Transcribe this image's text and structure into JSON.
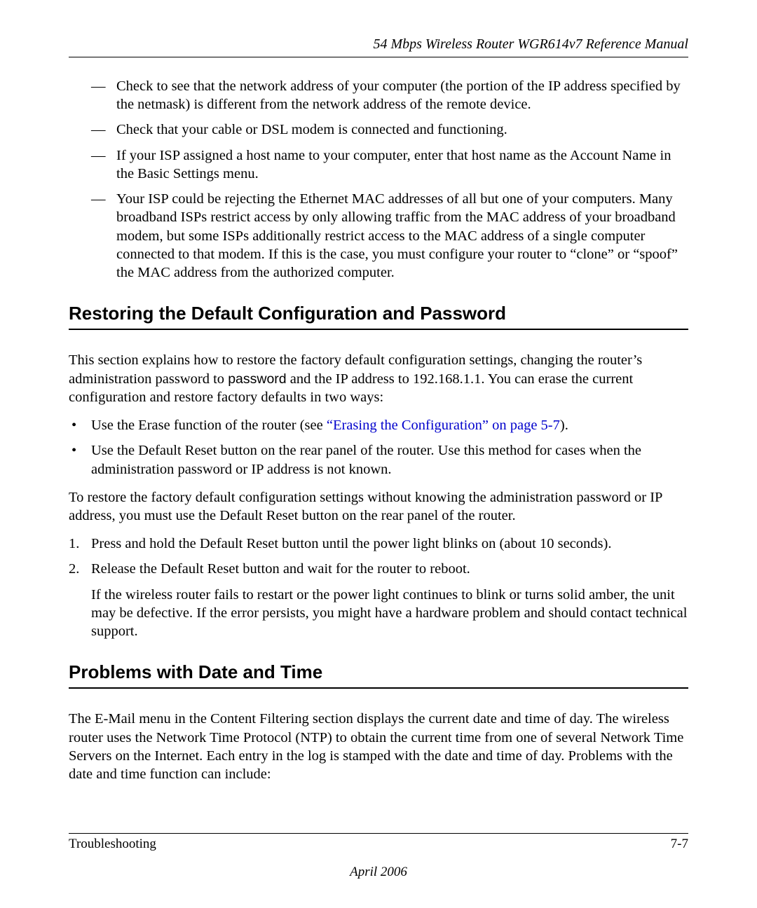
{
  "header": {
    "running_title": "54 Mbps Wireless Router WGR614v7 Reference Manual"
  },
  "dash_items": [
    "Check to see that the network address of your computer (the portion of the IP address specified by the netmask) is different from the network address of the remote device.",
    "Check that your cable or DSL modem is connected and functioning.",
    "If your ISP assigned a host name to your computer, enter that host name as the Account Name in the Basic Settings menu.",
    "Your ISP could be rejecting the Ethernet MAC addresses of all but one of your computers. Many broadband ISPs restrict access by only allowing traffic from the MAC address of your broadband modem, but some ISPs additionally restrict access to the MAC address of a single computer connected to that modem. If this is the case, you must configure your router to “clone” or “spoof” the MAC address from the authorized computer."
  ],
  "section1": {
    "title": "Restoring the Default Configuration and Password",
    "intro_pre": "This section explains how to restore the factory default configuration settings, changing the router’s administration password to ",
    "intro_code": "password",
    "intro_post": " and the IP address to 192.168.1.1. You can erase the current configuration and restore factory defaults in two ways:",
    "bullet1_pre": "Use the Erase function of the router (see ",
    "bullet1_link": "“Erasing the Configuration” on page 5-7",
    "bullet1_post": ").",
    "bullet2": "Use the Default Reset button on the rear panel of the router. Use this method for cases when the administration password or IP address is not known.",
    "para2": "To restore the factory default configuration settings without knowing the administration password or IP address, you must use the Default Reset button on the rear panel of the router.",
    "step1": "Press and hold the Default Reset button until the power light blinks on (about 10 seconds).",
    "step2": "Release the Default Reset button and wait for the router to reboot.",
    "step2_note": "If the wireless router fails to restart or the power light continues to blink or turns solid amber, the unit may be defective. If the error persists, you might have a hardware problem and should contact technical support."
  },
  "section2": {
    "title": "Problems with Date and Time",
    "intro": "The E-Mail menu in the Content Filtering section displays the current date and time of day. The wireless router uses the Network Time Protocol (NTP) to obtain the current time from one of several Network Time Servers on the Internet. Each entry in the log is stamped with the date and time of day. Problems with the date and time function can include:"
  },
  "footer": {
    "left": "Troubleshooting",
    "right": "7-7",
    "date": "April 2006"
  }
}
